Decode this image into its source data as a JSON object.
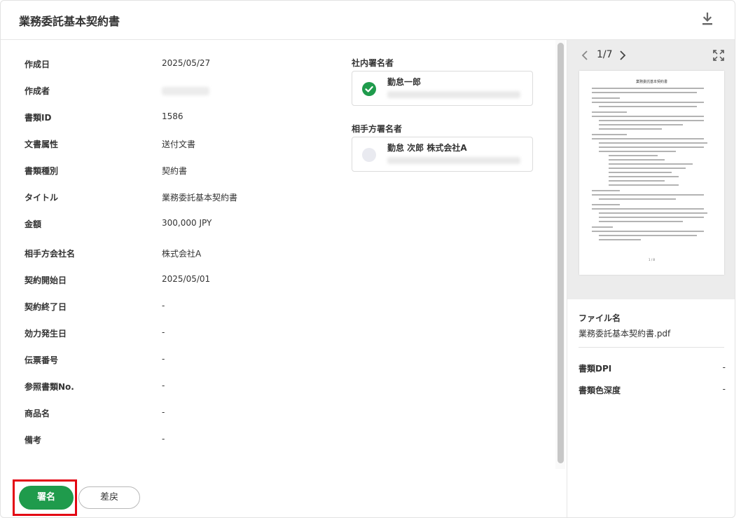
{
  "header": {
    "title": "業務委託基本契約書",
    "download_icon": "download-icon"
  },
  "fields": [
    {
      "label": "作成日",
      "value": "2025/05/27"
    },
    {
      "label": "作成者",
      "value": ""
    },
    {
      "label": "書類ID",
      "value": "1586"
    },
    {
      "label": "文書属性",
      "value": "送付文書"
    },
    {
      "label": "書類種別",
      "value": "契約書"
    },
    {
      "label": "タイトル",
      "value": "業務委託基本契約書"
    },
    {
      "label": "金額",
      "value": "300,000 JPY"
    },
    {
      "label": "相手方会社名",
      "value": "株式会社A"
    },
    {
      "label": "契約開始日",
      "value": "2025/05/01"
    },
    {
      "label": "契約終了日",
      "value": "-"
    },
    {
      "label": "効力発生日",
      "value": "-"
    },
    {
      "label": "伝票番号",
      "value": "-"
    },
    {
      "label": "参照書類No.",
      "value": "-"
    },
    {
      "label": "商品名",
      "value": "-"
    },
    {
      "label": "備考",
      "value": "-"
    }
  ],
  "signers": {
    "internal": {
      "section_label": "社内署名者",
      "name": "勤怠一郎",
      "status_icon": "check-circle-icon",
      "status_color": "#1f9b4c"
    },
    "counterparty": {
      "section_label": "相手方署名者",
      "name": "勤怠 次郎 株式会社A",
      "status_icon": "empty-circle-icon"
    }
  },
  "preview": {
    "page_indicator": "1/7",
    "prev_icon": "chevron-left-icon",
    "next_icon": "chevron-right-icon",
    "expand_icon": "expand-icon",
    "thumb_title": "業務委託基本契約書",
    "thumb_footer": "1 / 8"
  },
  "file_info": {
    "file_label": "ファイル名",
    "file_name": "業務委託基本契約書.pdf",
    "dpi_label": "書類DPI",
    "dpi_value": "-",
    "depth_label": "書類色深度",
    "depth_value": "-"
  },
  "actions": {
    "sign_label": "署名",
    "return_label": "差戻",
    "sign_color": "#1f9b4c",
    "highlight_color": "#e30613"
  }
}
